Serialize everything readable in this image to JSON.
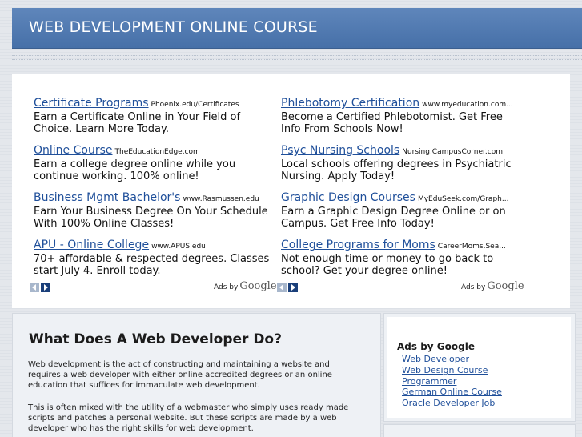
{
  "header": {
    "title": "WEB DEVELOPMENT ONLINE COURSE"
  },
  "ads": {
    "left": [
      {
        "title": "Certificate Programs",
        "url": "Phoenix.edu/Certificates",
        "text": "Earn a Certificate Online in Your Field of Choice. Learn More Today."
      },
      {
        "title": "Online Course",
        "url": "TheEducationEdge.com",
        "text": "Earn a college degree online while you continue working. 100% online!"
      },
      {
        "title": "Business Mgmt Bachelor's",
        "url": "www.Rasmussen.edu",
        "text": "Earn Your Business Degree On Your Schedule With 100% Online Classes!"
      },
      {
        "title": "APU - Online College",
        "url": "www.APUS.edu",
        "text": "70+ affordable & respected degrees. Classes start July 4. Enroll today."
      }
    ],
    "right": [
      {
        "title": "Phlebotomy Certification",
        "url": "www.myeducation.com...",
        "text": "Become a Certified Phlebotomist. Get Free Info From Schools Now!"
      },
      {
        "title": "Psyc Nursing Schools",
        "url": "Nursing.CampusCorner.com",
        "text": "Local schools offering degrees in Psychiatric Nursing. Apply Today!"
      },
      {
        "title": "Graphic Design Courses",
        "url": "MyEduSeek.com/Graph...",
        "text": "Earn a Graphic Design Degree Online or on Campus. Get Free Info Today!"
      },
      {
        "title": "College Programs for Moms",
        "url": "CareerMoms.Sea...",
        "text": "Not enough time or money to go back to school? Get your degree online!"
      }
    ],
    "ads_by_label": "Ads by",
    "google_label": "Google"
  },
  "article": {
    "title": "What Does A Web Developer Do?",
    "paragraphs": [
      "Web development is the act of constructing and maintaining a website and requires a web developer with either online accredited degrees or an online education that suffices for immaculate web development.",
      "This is often mixed with the utility of a webmaster who simply uses ready made scripts and patches a personal website. But these scripts are made by a web developer who has the right skills for web development."
    ]
  },
  "sidebar": {
    "title": "Ads by Google",
    "links": [
      "Web Developer",
      "Web Design Course",
      "Programmer",
      "German Online Course",
      "Oracle Developer Job"
    ]
  },
  "colors": {
    "header": "#4f77ae",
    "link": "#1f4f9a",
    "background": "#e4e7ec"
  }
}
